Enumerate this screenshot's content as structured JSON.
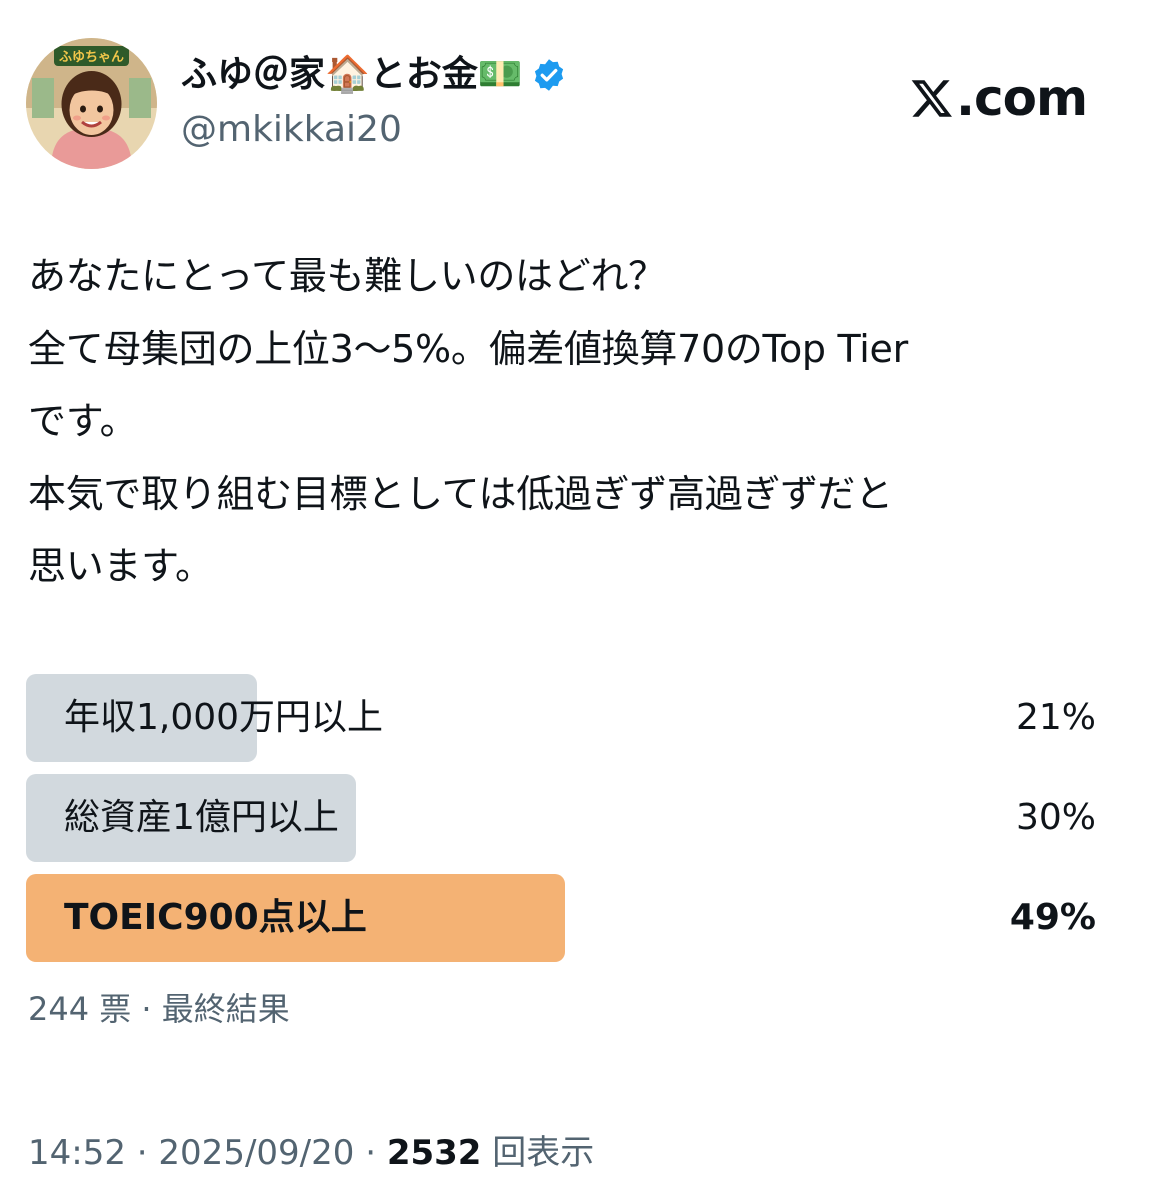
{
  "author": {
    "display_name": "ふゆ＠家🏠とお金💵",
    "handle": "@mkikkai20",
    "avatar_icon": "avatar-illustration-icon",
    "avatar_badge_text": "ふゆちゃん",
    "verified_color": "#1d9bf0"
  },
  "brand": {
    "text": ".com",
    "icon": "x-logo-icon"
  },
  "tweet": {
    "lines": [
      "あなたにとって最も難しいのはどれ？",
      "全て母集団の上位3〜5%。偏差値換算70のTop Tier",
      "です。",
      "本気で取り組む目標としては低過ぎず高過ぎずだと",
      "思います。"
    ]
  },
  "poll": {
    "options": [
      {
        "label": "年収1,000万円以上",
        "percent_text": "21%",
        "percent": 21,
        "leader": false
      },
      {
        "label": "総資産1億円以上",
        "percent_text": "30%",
        "percent": 30,
        "leader": false
      },
      {
        "label": "TOEIC900点以上",
        "percent_text": "49%",
        "percent": 49,
        "leader": true
      }
    ],
    "summary": "244 票 · 最終結果",
    "colors": {
      "fill": "#d2d9de",
      "leader_fill": "#f4b274"
    }
  },
  "meta": {
    "time": "14:52",
    "separator": " · ",
    "date": "2025/09/20",
    "views_count": "2532",
    "views_label": " 回表示"
  }
}
